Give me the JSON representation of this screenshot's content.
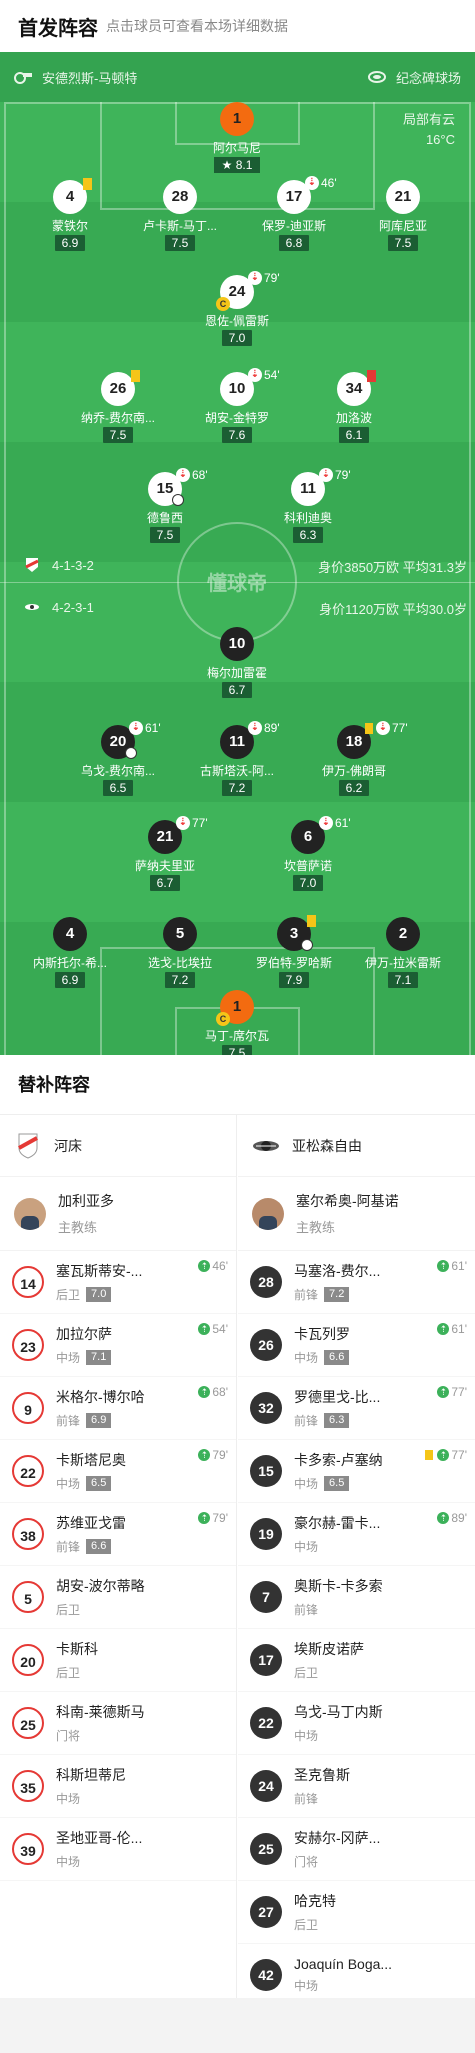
{
  "header": {
    "title": "首发阵容",
    "subtitle": "点击球员可查看本场详细数据"
  },
  "venue": {
    "referee": "安德烈斯-马顿特",
    "stadium": "纪念碑球场",
    "weather": "局部有云",
    "temp": "16°C"
  },
  "home": {
    "formation": "4-1-3-2",
    "value": "身价3850万欧",
    "age": "平均31.3岁",
    "players": [
      {
        "no": "1",
        "name": "阿尔马尼",
        "rating": "8.1",
        "star": true
      },
      {
        "no": "4",
        "name": "蒙铁尔",
        "rating": "6.9"
      },
      {
        "no": "28",
        "name": "卢卡斯-马丁...",
        "rating": "7.5"
      },
      {
        "no": "17",
        "name": "保罗-迪亚斯",
        "rating": "6.8",
        "sub": "46'"
      },
      {
        "no": "21",
        "name": "阿库尼亚",
        "rating": "7.5"
      },
      {
        "no": "24",
        "name": "恩佐-佩雷斯",
        "rating": "7.0",
        "sub": "79'"
      },
      {
        "no": "26",
        "name": "纳乔-费尔南...",
        "rating": "7.5"
      },
      {
        "no": "10",
        "name": "胡安-金特罗",
        "rating": "7.6",
        "sub": "54'"
      },
      {
        "no": "34",
        "name": "加洛波",
        "rating": "6.1"
      },
      {
        "no": "15",
        "name": "德鲁西",
        "rating": "7.5",
        "sub": "68'"
      },
      {
        "no": "11",
        "name": "科利迪奥",
        "rating": "6.3",
        "sub": "79'"
      }
    ]
  },
  "away": {
    "formation": "4-2-3-1",
    "value": "身价1120万欧",
    "age": "平均30.0岁",
    "players": [
      {
        "no": "10",
        "name": "梅尔加雷霍",
        "rating": "6.7"
      },
      {
        "no": "20",
        "name": "乌戈-费尔南...",
        "rating": "6.5",
        "sub": "61'"
      },
      {
        "no": "11",
        "name": "古斯塔沃-阿...",
        "rating": "7.2",
        "sub": "89'"
      },
      {
        "no": "18",
        "name": "伊万-佛朗哥",
        "rating": "6.2",
        "sub": "77'"
      },
      {
        "no": "21",
        "name": "萨纳夫里亚",
        "rating": "6.7",
        "sub": "77'"
      },
      {
        "no": "6",
        "name": "坎普萨诺",
        "rating": "7.0",
        "sub": "61'"
      },
      {
        "no": "4",
        "name": "内斯托尔-希...",
        "rating": "6.9"
      },
      {
        "no": "5",
        "name": "选戈-比埃拉",
        "rating": "7.2"
      },
      {
        "no": "3",
        "name": "罗伯特-罗哈斯",
        "rating": "7.9"
      },
      {
        "no": "2",
        "name": "伊万-拉米雷斯",
        "rating": "7.1"
      },
      {
        "no": "1",
        "name": "马丁-席尔瓦",
        "rating": "7.5"
      }
    ]
  },
  "watermark": "懂球帝",
  "subs": {
    "title": "替补阵容",
    "home": {
      "team": "河床",
      "coach": {
        "name": "加利亚多",
        "role": "主教练"
      },
      "list": [
        {
          "no": "14",
          "name": "塞瓦斯蒂安-...",
          "pos": "后卫",
          "score": "7.0",
          "min": "46'"
        },
        {
          "no": "23",
          "name": "加拉尔萨",
          "pos": "中场",
          "score": "7.1",
          "min": "54'"
        },
        {
          "no": "9",
          "name": "米格尔-博尔哈",
          "pos": "前锋",
          "score": "6.9",
          "min": "68'"
        },
        {
          "no": "22",
          "name": "卡斯塔尼奥",
          "pos": "中场",
          "score": "6.5",
          "min": "79'"
        },
        {
          "no": "38",
          "name": "苏维亚戈雷",
          "pos": "前锋",
          "score": "6.6",
          "min": "79'"
        },
        {
          "no": "5",
          "name": "胡安-波尔蒂略",
          "pos": "后卫"
        },
        {
          "no": "20",
          "name": "卡斯科",
          "pos": "后卫"
        },
        {
          "no": "25",
          "name": "科南-莱德斯马",
          "pos": "门将"
        },
        {
          "no": "35",
          "name": "科斯坦蒂尼",
          "pos": "中场"
        },
        {
          "no": "39",
          "name": "圣地亚哥-伦...",
          "pos": "中场"
        }
      ]
    },
    "away": {
      "team": "亚松森自由",
      "coach": {
        "name": "塞尔希奥-阿基诺",
        "role": "主教练"
      },
      "list": [
        {
          "no": "28",
          "name": "马塞洛-费尔...",
          "pos": "前锋",
          "score": "7.2",
          "min": "61'"
        },
        {
          "no": "26",
          "name": "卡瓦列罗",
          "pos": "中场",
          "score": "6.6",
          "min": "61'"
        },
        {
          "no": "32",
          "name": "罗德里戈-比...",
          "pos": "前锋",
          "score": "6.3",
          "min": "77'"
        },
        {
          "no": "15",
          "name": "卡多索-卢塞纳",
          "pos": "中场",
          "score": "6.5",
          "min": "77'",
          "card": true
        },
        {
          "no": "19",
          "name": "豪尔赫-雷卡...",
          "pos": "中场",
          "min": "89'"
        },
        {
          "no": "7",
          "name": "奥斯卡-卡多索",
          "pos": "前锋"
        },
        {
          "no": "17",
          "name": "埃斯皮诺萨",
          "pos": "后卫"
        },
        {
          "no": "22",
          "name": "乌戈-马丁内斯",
          "pos": "中场"
        },
        {
          "no": "24",
          "name": "圣克鲁斯",
          "pos": "前锋"
        },
        {
          "no": "25",
          "name": "安赫尔-冈萨...",
          "pos": "门将"
        },
        {
          "no": "27",
          "name": "哈克特",
          "pos": "后卫"
        },
        {
          "no": "42",
          "name": "Joaquín Boga...",
          "pos": "中场"
        }
      ]
    }
  }
}
